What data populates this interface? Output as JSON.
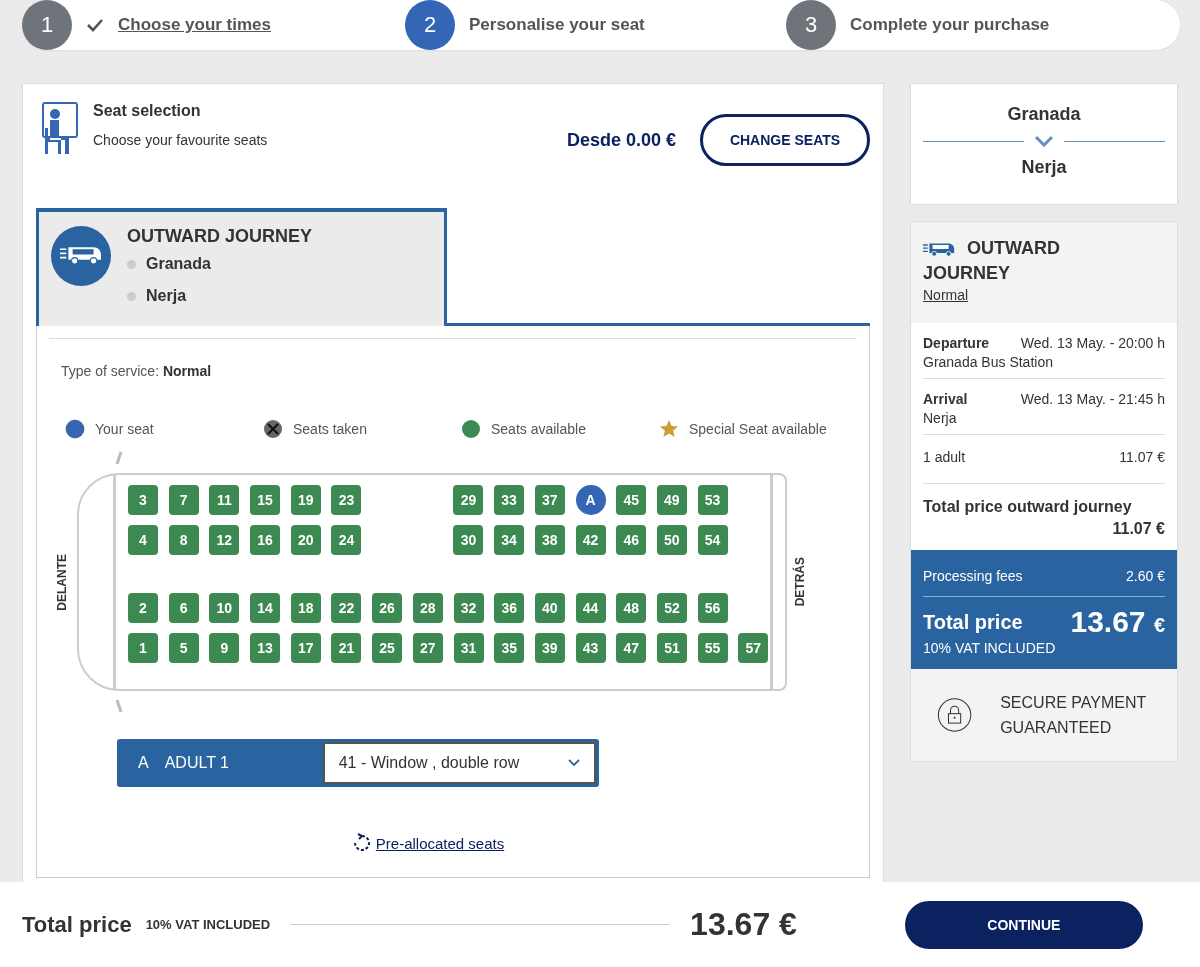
{
  "steps": [
    {
      "number": "1",
      "label": "Choose your times",
      "done": true,
      "selected": false
    },
    {
      "number": "2",
      "label": "Personalise your seat",
      "done": false,
      "selected": true
    },
    {
      "number": "3",
      "label": "Complete your purchase",
      "done": false,
      "selected": false
    }
  ],
  "seat_selection": {
    "title": "Seat selection",
    "subtitle": "Choose your favourite seats",
    "price": "Desde 0.00 €",
    "button": "CHANGE SEATS"
  },
  "journey_tab": {
    "title": "OUTWARD JOURNEY",
    "origin": "Granada",
    "destination": "Nerja",
    "selected": true
  },
  "service": {
    "label": "Type of service:",
    "value": "Normal"
  },
  "legend": [
    {
      "kind": "selected",
      "label": "Your seat"
    },
    {
      "kind": "taken",
      "label": "Seats taken"
    },
    {
      "kind": "available",
      "label": "Seats available"
    },
    {
      "kind": "special",
      "label": "Special Seat available"
    }
  ],
  "bus": {
    "front_label": "DELANTE",
    "rear_label": "DETRÁS",
    "blocks": [
      {
        "rows": [
          {
            "segments": [
              [
                {
                  "label": "3",
                  "selected": false
                },
                {
                  "label": "7",
                  "selected": false
                },
                {
                  "label": "11",
                  "selected": false
                },
                {
                  "label": "15",
                  "selected": false
                },
                {
                  "label": "19",
                  "selected": false
                },
                {
                  "label": "23",
                  "selected": false
                }
              ],
              [
                {
                  "label": "29",
                  "selected": false
                },
                {
                  "label": "33",
                  "selected": false
                },
                {
                  "label": "37",
                  "selected": false
                },
                {
                  "label": "A",
                  "selected": true
                },
                {
                  "label": "45",
                  "selected": false
                },
                {
                  "label": "49",
                  "selected": false
                },
                {
                  "label": "53",
                  "selected": false
                }
              ]
            ]
          },
          {
            "segments": [
              [
                {
                  "label": "4",
                  "selected": false
                },
                {
                  "label": "8",
                  "selected": false
                },
                {
                  "label": "12",
                  "selected": false
                },
                {
                  "label": "16",
                  "selected": false
                },
                {
                  "label": "20",
                  "selected": false
                },
                {
                  "label": "24",
                  "selected": false
                }
              ],
              [
                {
                  "label": "30",
                  "selected": false
                },
                {
                  "label": "34",
                  "selected": false
                },
                {
                  "label": "38",
                  "selected": false
                },
                {
                  "label": "42",
                  "selected": false
                },
                {
                  "label": "46",
                  "selected": false
                },
                {
                  "label": "50",
                  "selected": false
                },
                {
                  "label": "54",
                  "selected": false
                }
              ]
            ]
          }
        ]
      },
      {
        "rows": [
          {
            "segments": [
              [
                {
                  "label": "2",
                  "selected": false
                },
                {
                  "label": "6",
                  "selected": false
                },
                {
                  "label": "10",
                  "selected": false
                },
                {
                  "label": "14",
                  "selected": false
                },
                {
                  "label": "18",
                  "selected": false
                },
                {
                  "label": "22",
                  "selected": false
                },
                {
                  "label": "26",
                  "selected": false
                },
                {
                  "label": "28",
                  "selected": false
                },
                {
                  "label": "32",
                  "selected": false
                },
                {
                  "label": "36",
                  "selected": false
                },
                {
                  "label": "40",
                  "selected": false
                },
                {
                  "label": "44",
                  "selected": false
                },
                {
                  "label": "48",
                  "selected": false
                },
                {
                  "label": "52",
                  "selected": false
                },
                {
                  "label": "56",
                  "selected": false
                }
              ]
            ]
          },
          {
            "segments": [
              [
                {
                  "label": "1",
                  "selected": false
                },
                {
                  "label": "5",
                  "selected": false
                },
                {
                  "label": "9",
                  "selected": false
                },
                {
                  "label": "13",
                  "selected": false
                },
                {
                  "label": "17",
                  "selected": false
                },
                {
                  "label": "21",
                  "selected": false
                },
                {
                  "label": "25",
                  "selected": false
                },
                {
                  "label": "27",
                  "selected": false
                },
                {
                  "label": "31",
                  "selected": false
                },
                {
                  "label": "35",
                  "selected": false
                },
                {
                  "label": "39",
                  "selected": false
                },
                {
                  "label": "43",
                  "selected": false
                },
                {
                  "label": "47",
                  "selected": false
                },
                {
                  "label": "51",
                  "selected": false
                },
                {
                  "label": "55",
                  "selected": false
                },
                {
                  "label": "57",
                  "selected": false
                }
              ]
            ]
          }
        ]
      }
    ]
  },
  "passenger": {
    "letter": "A",
    "label": "ADULT 1",
    "seat": "41 - Window , double row"
  },
  "preallocated_link": "Pre-allocated seats",
  "route": {
    "origin": "Granada",
    "destination": "Nerja"
  },
  "summary": {
    "title": "OUTWARD JOURNEY",
    "service": "Normal",
    "legs": [
      {
        "label": "Departure",
        "time": "Wed. 13 May. - 20:00 h",
        "place": "Granada Bus Station"
      },
      {
        "label": "Arrival",
        "time": "Wed. 13 May. - 21:45 h",
        "place": "Nerja"
      }
    ],
    "passengers": {
      "label": "1 adult",
      "price": "11.07 €"
    },
    "journey_total": {
      "label": "Total price outward journey",
      "price": "11.07 €"
    },
    "fees": {
      "label": "Processing fees",
      "price": "2.60 €"
    },
    "total": {
      "label": "Total price",
      "amount": "13.67",
      "currency": "€",
      "vat": "10% VAT INCLUDED"
    },
    "secure": "SECURE PAYMENT GUARANTEED"
  },
  "footer": {
    "label": "Total price",
    "vat": "10% VAT INCLUDED",
    "amount": "13.67 €",
    "button": "CONTINUE"
  }
}
